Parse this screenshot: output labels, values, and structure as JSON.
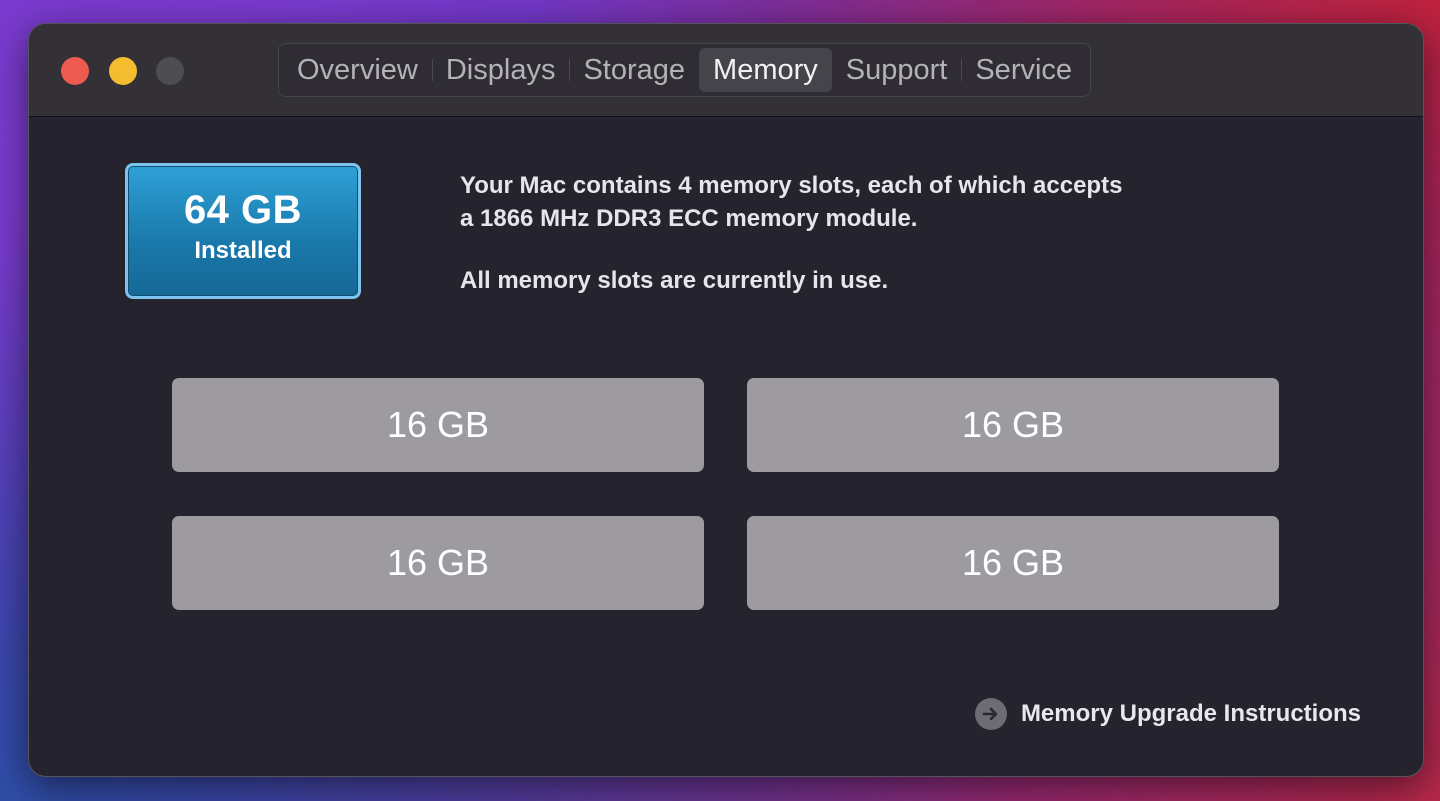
{
  "tabs": [
    {
      "label": "Overview",
      "active": false
    },
    {
      "label": "Displays",
      "active": false
    },
    {
      "label": "Storage",
      "active": false
    },
    {
      "label": "Memory",
      "active": true
    },
    {
      "label": "Support",
      "active": false
    },
    {
      "label": "Service",
      "active": false
    }
  ],
  "memory": {
    "installed_size": "64 GB",
    "installed_label": "Installed",
    "description_line1": "Your Mac contains 4 memory slots, each of which accepts",
    "description_line2": "a 1866 MHz DDR3 ECC memory module.",
    "status_text": "All memory slots are currently in use.",
    "slots": [
      "16 GB",
      "16 GB",
      "16 GB",
      "16 GB"
    ],
    "upgrade_link": "Memory Upgrade Instructions"
  },
  "colors": {
    "accent": "#1f86bd",
    "slot_fill": "#9d9ba0",
    "window_bg": "#25232d"
  },
  "icons": {
    "close": "close-traffic-light",
    "minimize": "minimize-traffic-light",
    "zoom": "zoom-traffic-light",
    "upgrade": "arrow-right-circle-icon"
  }
}
